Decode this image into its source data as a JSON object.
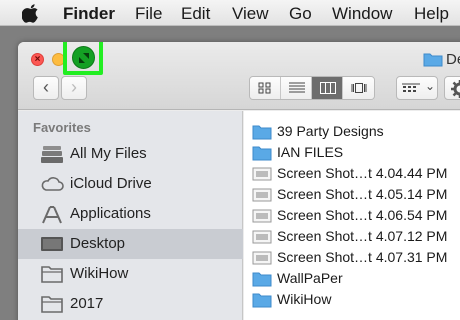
{
  "menubar": {
    "app_name": "Finder",
    "items": [
      "File",
      "Edit",
      "View",
      "Go",
      "Window",
      "Help"
    ]
  },
  "window": {
    "title": "De",
    "highlight_color": "#22ee22"
  },
  "sidebar": {
    "heading": "Favorites",
    "items": [
      {
        "label": "All My Files",
        "icon": "all-files-icon"
      },
      {
        "label": "iCloud Drive",
        "icon": "cloud-icon"
      },
      {
        "label": "Applications",
        "icon": "applications-icon"
      },
      {
        "label": "Desktop",
        "icon": "desktop-icon",
        "selected": true
      },
      {
        "label": "WikiHow",
        "icon": "folder-icon"
      },
      {
        "label": "2017",
        "icon": "folder-icon"
      }
    ]
  },
  "files": [
    {
      "name": "39 Party Designs",
      "type": "folder"
    },
    {
      "name": "IAN FILES",
      "type": "folder"
    },
    {
      "name": "Screen Shot…t 4.04.44 PM",
      "type": "image"
    },
    {
      "name": "Screen Shot…t 4.05.14 PM",
      "type": "image"
    },
    {
      "name": "Screen Shot…t 4.06.54 PM",
      "type": "image"
    },
    {
      "name": "Screen Shot…t 4.07.12 PM",
      "type": "image"
    },
    {
      "name": "Screen Shot…t 4.07.31 PM",
      "type": "image"
    },
    {
      "name": "WallPaPer",
      "type": "folder"
    },
    {
      "name": "WikiHow",
      "type": "folder"
    }
  ],
  "colors": {
    "folder": "#5aa9e6",
    "selected_row": "#c9ccd2",
    "close": "#fc5753",
    "minimize": "#fdbc40",
    "zoom": "#34c84a"
  }
}
